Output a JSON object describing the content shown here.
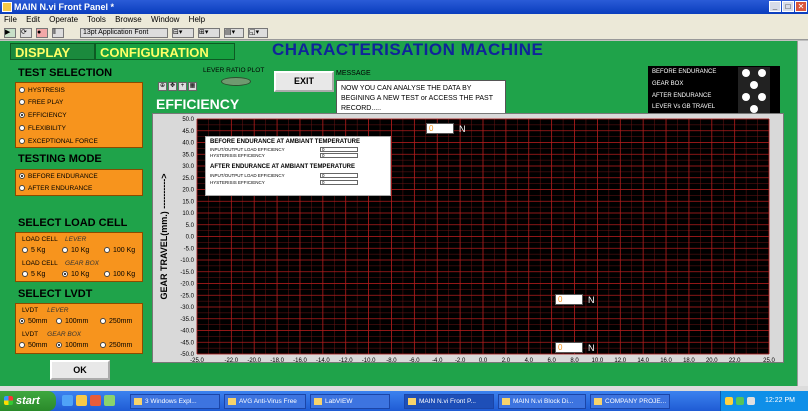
{
  "window": {
    "title": "MAIN N.vi Front Panel *",
    "minimize": "_",
    "maximize": "□",
    "close": "✕"
  },
  "menu": [
    "File",
    "Edit",
    "Operate",
    "Tools",
    "Browse",
    "Window",
    "Help"
  ],
  "toolbar": {
    "font_selector": "13pt Application Font"
  },
  "tabs": {
    "display": "DISPLAY",
    "configuration": "CONFIGURATION"
  },
  "machine_title": "CHARACTERISATION MACHINE",
  "test_selection": {
    "heading": "TEST SELECTION",
    "options": [
      "HYSTRESIS",
      "FREE PLAY",
      "EFFICIENCY",
      "FLEXIBILITY",
      "EXCEPTIONAL FORCE"
    ],
    "selected": "EFFICIENCY"
  },
  "testing_mode": {
    "heading": "TESTING MODE",
    "options": [
      "BEFORE ENDURANCE",
      "AFTER ENDURANCE"
    ],
    "selected": "BEFORE ENDURANCE"
  },
  "load_cell": {
    "heading": "SELECT LOAD CELL",
    "rows": [
      {
        "label": "LOAD CELL",
        "part": "LEVER",
        "options": [
          "5 Kg",
          "10 Kg",
          "100 Kg"
        ]
      },
      {
        "label": "LOAD CELL",
        "part": "GEAR BOX",
        "options": [
          "5 Kg",
          "10 Kg",
          "100 Kg"
        ]
      }
    ]
  },
  "lvdt": {
    "heading": "SELECT LVDT",
    "rows": [
      {
        "label": "LVDT",
        "part": "LEVER",
        "options": [
          "50mm",
          "100mm",
          "250mm"
        ]
      },
      {
        "label": "LVDT",
        "part": "GEAR BOX",
        "options": [
          "50mm",
          "100mm",
          "250mm"
        ]
      }
    ]
  },
  "buttons": {
    "ok": "OK",
    "exit": "EXIT"
  },
  "lever_ratio_plot": "LEVER RATIO PLOT",
  "message": {
    "label": "MESSAGE",
    "text": "NOW YOU CAN ANALYSE THE DATA BY BEGINING A NEW TEST or ACCESS THE PAST RECORD....."
  },
  "plot_title": "EFFICIENCY",
  "legend": [
    "BEFORE ENDURANCE",
    "GEAR BOX",
    "AFTER ENDURANCE",
    "LEVER Vs GB TRAVEL"
  ],
  "info_panel": {
    "before_heading": "BEFORE ENDURANCE AT AMBIANT TEMPERATURE",
    "before_rows": [
      {
        "label": "INPUT/OUTPUT LOAD EFFICIENCY",
        "value": "0"
      },
      {
        "label": "HYSTERISIS EFFICIENCY",
        "value": "0"
      }
    ],
    "after_heading": "AFTER ENDURANCE AT AMBIANT TEMPERATURE",
    "after_rows": [
      {
        "label": "INPUT/OUTPUT LOAD EFFICIENCY",
        "value": "0"
      },
      {
        "label": "HYSTERISIS EFFICIENCY",
        "value": "0"
      }
    ]
  },
  "value_fields": [
    {
      "value": "0",
      "unit": "N"
    },
    {
      "value": "0",
      "unit": "N"
    },
    {
      "value": "0",
      "unit": "N"
    }
  ],
  "chart_data": {
    "type": "line",
    "xlabel": "LEVER TRAVEL(mm.) ---------->",
    "ylabel": "GEAR TRAVEL(mm.) ---------->",
    "xlim": [
      -25.0,
      25.0
    ],
    "ylim": [
      -50.0,
      50.0
    ],
    "xticks": [
      -25.0,
      -22.0,
      -20.0,
      -18.0,
      -16.0,
      -14.0,
      -12.0,
      -10.0,
      -8.0,
      -6.0,
      -4.0,
      -2.0,
      0.0,
      2.0,
      4.0,
      6.0,
      8.0,
      10.0,
      12.0,
      14.0,
      16.0,
      18.0,
      20.0,
      22.0,
      25.0
    ],
    "yticks": [
      50.0,
      45.0,
      40.0,
      35.0,
      30.0,
      25.0,
      20.0,
      15.0,
      10.0,
      5.0,
      0.0,
      -5.0,
      -10.0,
      -15.0,
      -20.0,
      -25.0,
      -30.0,
      -35.0,
      -40.0,
      -45.0,
      -50.0
    ],
    "grid": true,
    "series": []
  },
  "taskbar": {
    "start": "start",
    "tasks": [
      "3 Windows Expl...",
      "AVG Anti-Virus Free",
      "LabVIEW",
      "MAIN N.vi Front P...",
      "MAIN N.vi Block Di...",
      "COMPANY PROJE..."
    ],
    "clock": "12:22 PM"
  },
  "colors": {
    "panel_green": "#1fa34a",
    "accent_orange": "#f7941d",
    "title_blue": "#10249a",
    "tab_yellow": "#ffff66"
  }
}
